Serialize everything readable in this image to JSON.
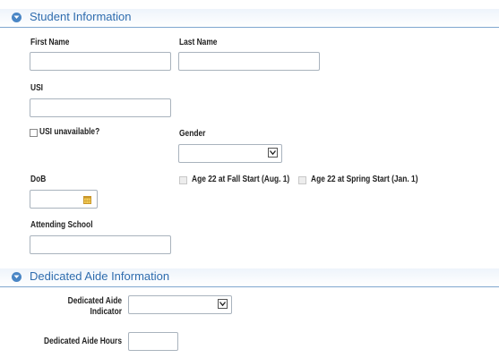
{
  "student_section": {
    "title": "Student Information",
    "first_name_label": "First Name",
    "first_name_value": "",
    "last_name_label": "Last Name",
    "last_name_value": "",
    "usi_label": "USI",
    "usi_value": "",
    "usi_unavailable_label": "USI unavailable?",
    "usi_unavailable_checked": false,
    "gender_label": "Gender",
    "gender_value": "",
    "dob_label": "DoB",
    "dob_value": "",
    "age_fall_label": "Age 22 at Fall Start (Aug. 1)",
    "age_spring_label": "Age 22 at Spring Start (Jan. 1)",
    "attending_school_label": "Attending School",
    "attending_school_value": ""
  },
  "aide_section": {
    "title": "Dedicated Aide Information",
    "indicator_label_line1": "Dedicated Aide",
    "indicator_label_line2": "Indicator",
    "indicator_value": "",
    "hours_label": "Dedicated Aide Hours",
    "hours_value": ""
  },
  "colors": {
    "header_text": "#2e6cae",
    "header_line": "#7fa7cf",
    "calendar_icon": "#e0b33a"
  }
}
